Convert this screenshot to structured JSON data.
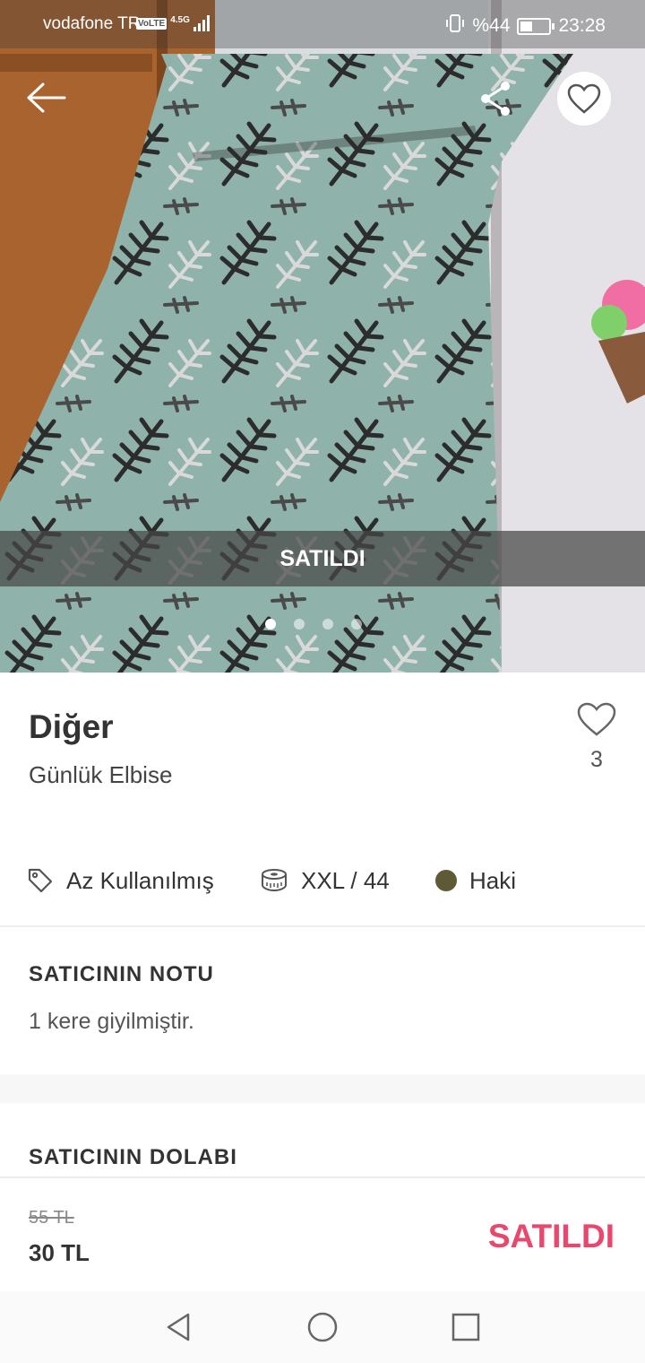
{
  "status_bar": {
    "carrier": "vodafone TR",
    "volte": "VoLTE",
    "network_type": "4.5G",
    "battery_text": "%44",
    "battery_level": 0.44,
    "time": "23:28"
  },
  "gallery": {
    "sold_overlay": "SATILDI",
    "image_count": 4,
    "active_index": 0
  },
  "product": {
    "brand": "Diğer",
    "category": "Günlük Elbise",
    "like_count": "3",
    "condition": "Az Kullanılmış",
    "size": "XXL / 44",
    "color_name": "Haki",
    "color_hex": "#5e5a36"
  },
  "seller_note": {
    "title": "SATICININ NOTU",
    "text": "1 kere giyilmiştir."
  },
  "seller_closet": {
    "title": "SATICININ DOLABI"
  },
  "pricing": {
    "old_price": "55 TL",
    "price": "30 TL",
    "status": "SATILDI",
    "accent": "#e8476e"
  }
}
